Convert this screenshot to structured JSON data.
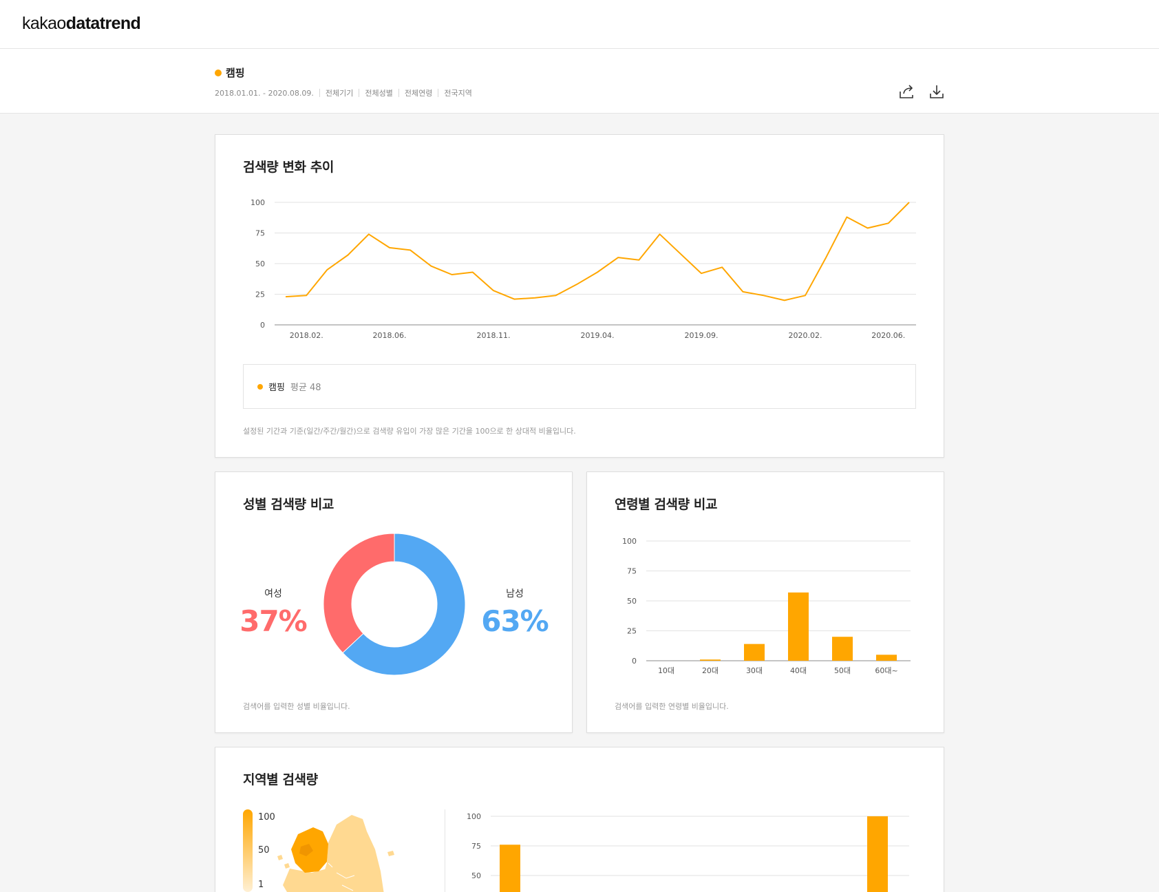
{
  "header": {
    "logo_light": "kakao",
    "logo_bold": "datatrend"
  },
  "filter": {
    "keyword": "캠핑",
    "period": "2018.01.01. - 2020.08.09.",
    "device": "전체기기",
    "gender": "전체성별",
    "age": "전체연령",
    "region": "전국지역",
    "share_icon": "share-icon",
    "download_icon": "download-icon"
  },
  "colors": {
    "accent": "#ffa600",
    "female": "#ff6b6b",
    "male": "#53a8f3"
  },
  "trend": {
    "title": "검색량 변화 추이",
    "legend_name": "캠핑",
    "legend_avg": "평균 48",
    "note": "설정된 기간과 기준(일간/주간/월간)으로 검색량 유입이 가장 많은 기간을 100으로 한 상대적 비율입니다.",
    "chart_data": {
      "type": "line",
      "x": [
        "2018.01.",
        "2018.02.",
        "2018.03.",
        "2018.04.",
        "2018.05.",
        "2018.06.",
        "2018.07.",
        "2018.08.",
        "2018.09.",
        "2018.10.",
        "2018.11.",
        "2018.12.",
        "2019.01.",
        "2019.02.",
        "2019.03.",
        "2019.04.",
        "2019.05.",
        "2019.06.",
        "2019.07.",
        "2019.08.",
        "2019.09.",
        "2019.10.",
        "2019.11.",
        "2019.12.",
        "2020.01.",
        "2020.02.",
        "2020.03.",
        "2020.04.",
        "2020.05.",
        "2020.06.",
        "2020.07."
      ],
      "x_ticks": [
        "2018.02.",
        "2018.06.",
        "2018.11.",
        "2019.04.",
        "2019.09.",
        "2020.02.",
        "2020.06."
      ],
      "series": [
        {
          "name": "캠핑",
          "values": [
            23,
            24,
            45,
            57,
            74,
            63,
            61,
            48,
            41,
            43,
            28,
            21,
            22,
            24,
            33,
            43,
            55,
            53,
            74,
            58,
            42,
            47,
            27,
            24,
            20,
            24,
            55,
            88,
            79,
            83,
            100
          ]
        }
      ],
      "ylim": [
        0,
        100
      ],
      "yticks": [
        0,
        25,
        50,
        75,
        100
      ]
    }
  },
  "gender": {
    "title": "성별 검색량 비교",
    "female_label": "여성",
    "female_pct": "37%",
    "male_label": "남성",
    "male_pct": "63%",
    "note": "검색어를 입력한 성별 비율입니다.",
    "chart_data": {
      "type": "pie",
      "categories": [
        "여성",
        "남성"
      ],
      "values": [
        37,
        63
      ]
    }
  },
  "age": {
    "title": "연령별 검색량 비교",
    "note": "검색어를 입력한 연령별 비율입니다.",
    "chart_data": {
      "type": "bar",
      "categories": [
        "10대",
        "20대",
        "30대",
        "40대",
        "50대",
        "60대~"
      ],
      "values": [
        0,
        1,
        14,
        57,
        20,
        5
      ],
      "ylim": [
        0,
        100
      ],
      "yticks": [
        0,
        25,
        50,
        75,
        100
      ]
    }
  },
  "region": {
    "title": "지역별 검색량",
    "scale_max": "100",
    "scale_mid": "50",
    "scale_min": "1",
    "chart_data": {
      "type": "bar",
      "values": [
        76,
        100
      ],
      "ylim": [
        0,
        100
      ],
      "yticks": [
        50,
        75,
        100
      ]
    }
  }
}
